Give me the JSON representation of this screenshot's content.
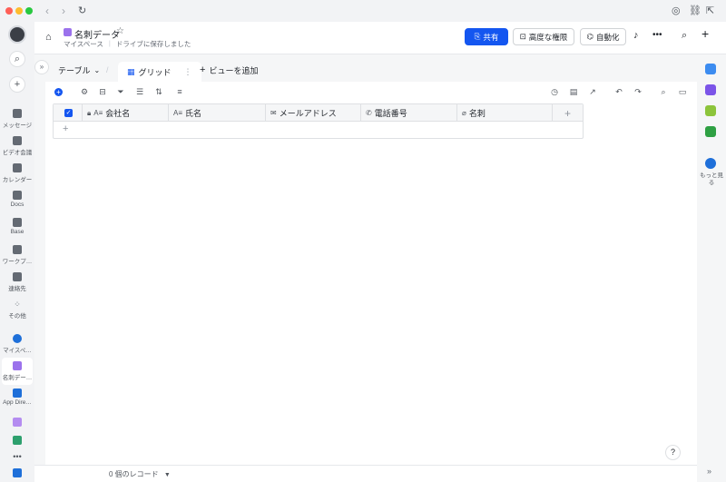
{
  "window": {
    "traffic_lights": [
      "#ff5f57",
      "#febc2e",
      "#28c840"
    ]
  },
  "rail": {
    "items": [
      {
        "label": "メッセージ",
        "icon": "chat-icon"
      },
      {
        "label": "ビデオ会議",
        "icon": "video-icon"
      },
      {
        "label": "カレンダー",
        "icon": "calendar-icon"
      },
      {
        "label": "Docs",
        "icon": "docs-icon"
      },
      {
        "label": "Base",
        "icon": "base-icon"
      },
      {
        "label": "ワークプ…",
        "icon": "workplace-icon"
      },
      {
        "label": "連絡先",
        "icon": "contacts-icon"
      },
      {
        "label": "その他",
        "icon": "more-icon"
      },
      {
        "label": "マイスペ…",
        "icon": "myspace-icon"
      },
      {
        "label": "名刺デー…",
        "icon": "base-doc-icon"
      },
      {
        "label": "App Dire…",
        "icon": "app-directory-icon"
      }
    ]
  },
  "header": {
    "title": "名刺データ",
    "breadcrumb_location": "マイスペース",
    "save_status": "ドライブに保存しました",
    "share_label": "共有",
    "permissions_label": "高度な権限",
    "automation_label": "自動化"
  },
  "tabs": {
    "table_label": "テーブル",
    "view_label": "グリッド",
    "add_view_label": "ビューを追加"
  },
  "grid": {
    "columns": [
      {
        "label": "会社名",
        "icon": "text-field-icon"
      },
      {
        "label": "氏名",
        "icon": "text-field-icon"
      },
      {
        "label": "メールアドレス",
        "icon": "email-field-icon"
      },
      {
        "label": "電話番号",
        "icon": "phone-field-icon"
      },
      {
        "label": "名刺",
        "icon": "attachment-field-icon"
      }
    ]
  },
  "footer": {
    "record_count": "0 個のレコード"
  },
  "right_rail": {
    "more_label": "もっと見る",
    "apps": [
      {
        "icon": "app-blue-icon",
        "color": "#3c8cf0"
      },
      {
        "icon": "app-purple-icon",
        "color": "#7b54e8"
      },
      {
        "icon": "app-lime-icon",
        "color": "#8cc43b"
      },
      {
        "icon": "app-green-icon",
        "color": "#2ea043"
      }
    ]
  },
  "colors": {
    "accent": "#1456f0",
    "doc_icon": "#9b72ec"
  }
}
